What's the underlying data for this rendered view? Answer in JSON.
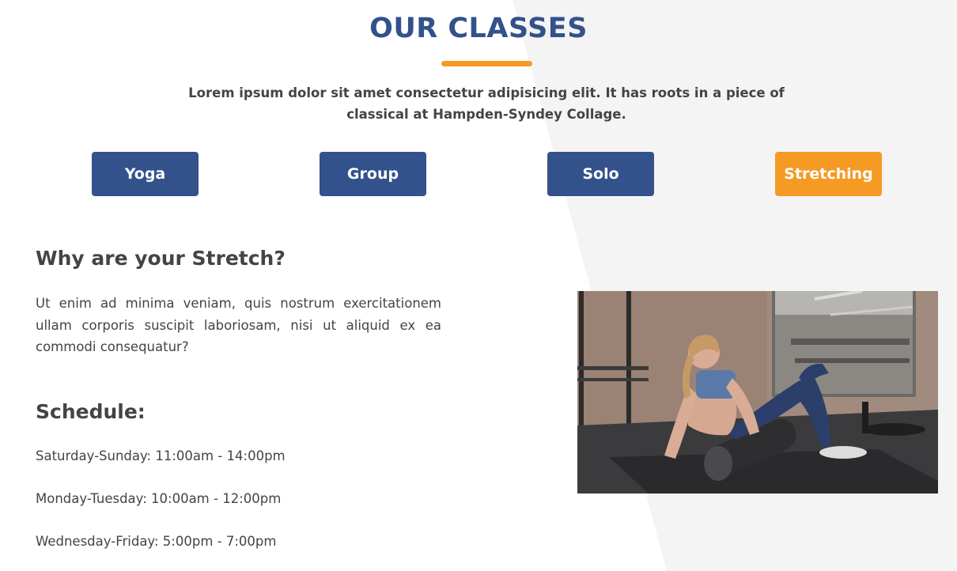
{
  "theme": {
    "primary": "#33518b",
    "accent": "#f59a23",
    "text": "#444444",
    "background_shape": "#f4f4f4"
  },
  "section": {
    "title": "OUR CLASSES",
    "intro": "Lorem ipsum dolor sit amet consectetur adipisicing elit. It has roots in a piece of classical at Hampden-Syndey Collage."
  },
  "tabs": [
    {
      "label": "Yoga",
      "active": false
    },
    {
      "label": "Group",
      "active": false
    },
    {
      "label": "Solo",
      "active": false
    },
    {
      "label": "Stretching",
      "active": true
    }
  ],
  "content": {
    "why_heading": "Why are your Stretch?",
    "description": "Ut enim ad minima veniam, quis nostrum exercitationem ullam corporis suscipit laboriosam, nisi ut aliquid ex ea commodi consequatur?",
    "schedule_heading": "Schedule:",
    "schedule": [
      "Saturday-Sunday: 11:00am - 14:00pm",
      "Monday-Tuesday: 10:00am - 12:00pm",
      "Wednesday-Friday: 5:00pm - 7:00pm"
    ],
    "image_icon": "stretching-photo"
  }
}
